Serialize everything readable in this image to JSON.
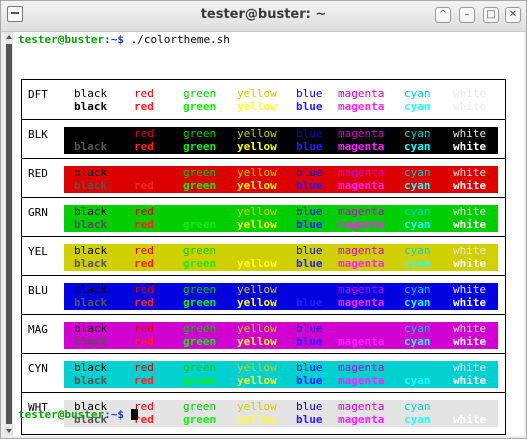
{
  "window": {
    "title": "tester@buster: ~"
  },
  "terminal": {
    "prompt_user": "tester@buster",
    "prompt_path": ":~$",
    "command": " ./colortheme.sh",
    "prompt_user_2": "tester@buster",
    "prompt_path_2": ":~$"
  },
  "palette": {
    "black": "#000000",
    "red": "#dd0000",
    "green": "#00ce00",
    "yellow": "#d0d000",
    "blue": "#0000e0",
    "magenta": "#d000d0",
    "cyan": "#00d0d0",
    "white": "#e4e4e4",
    "bold_red": "#ff2020",
    "bold_green": "#10ef10",
    "bold_yellow": "#ffff20",
    "bold_blue": "#2020ff",
    "bold_magenta": "#ff20ff",
    "bold_cyan": "#20ffff",
    "bold_white": "#ffffff",
    "bold_black": "#555555"
  },
  "columns": [
    "black",
    "red",
    "green",
    "yellow",
    "blue",
    "magenta",
    "cyan",
    "white"
  ],
  "rows": [
    {
      "label": "DFT",
      "bg": ""
    },
    {
      "label": "BLK",
      "bg": "black"
    },
    {
      "label": "RED",
      "bg": "red"
    },
    {
      "label": "GRN",
      "bg": "green"
    },
    {
      "label": "YEL",
      "bg": "yellow"
    },
    {
      "label": "BLU",
      "bg": "blue"
    },
    {
      "label": "MAG",
      "bg": "magenta"
    },
    {
      "label": "CYN",
      "bg": "cyan"
    },
    {
      "label": "WHT",
      "bg": "white"
    }
  ]
}
